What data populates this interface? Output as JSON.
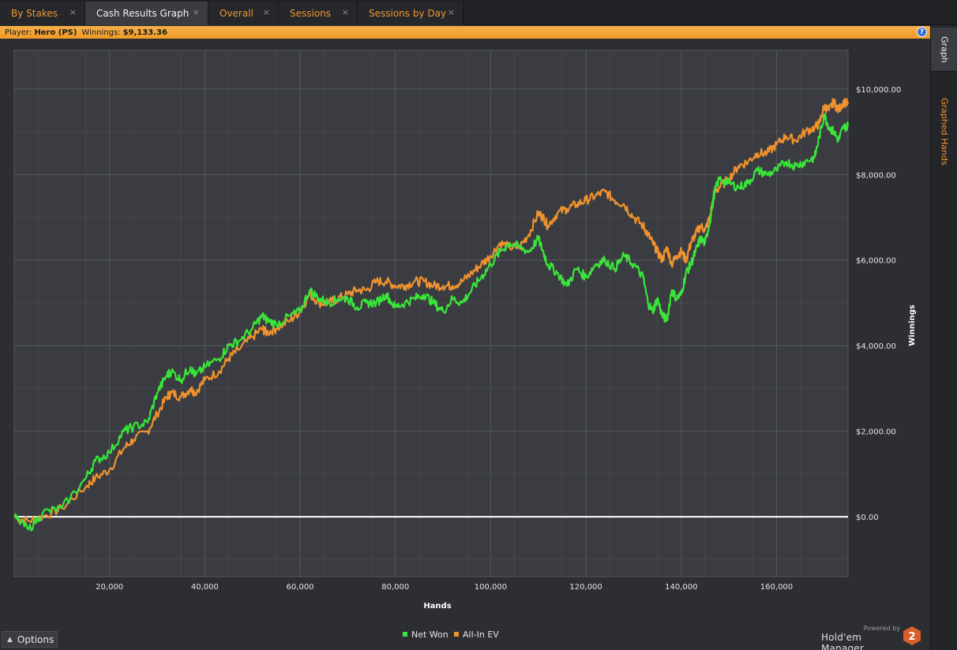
{
  "tabs": [
    {
      "label": "By Stakes",
      "active": false
    },
    {
      "label": "Cash Results Graph",
      "active": true
    },
    {
      "label": "Overall",
      "active": false
    },
    {
      "label": "Sessions",
      "active": false
    },
    {
      "label": "Sessions by Day",
      "active": false
    }
  ],
  "close_glyph": "×",
  "player_bar": {
    "player_label": "Player:",
    "player_value": "Hero (PS)",
    "winnings_label": "Winnings:",
    "winnings_value": "$9,133.36",
    "help_glyph": "?"
  },
  "side_tabs": {
    "graph": "Graph",
    "graphed_hands": "Graphed Hands"
  },
  "options_label": "Options",
  "brand": {
    "powered_by": "Powered by",
    "name": "Hold'em Manager",
    "logo_number": "2"
  },
  "colors": {
    "net_won": "#39e639",
    "all_in_ev": "#f0922e",
    "accent": "#f0962e",
    "zero_line": "#ffffff"
  },
  "chart_data": {
    "type": "line",
    "xlabel": "Hands",
    "ylabel": "Winnings",
    "xlim": [
      0,
      175000
    ],
    "ylim": [
      -1400,
      10900
    ],
    "x_ticks": [
      20000,
      40000,
      60000,
      80000,
      100000,
      120000,
      140000,
      160000
    ],
    "x_tick_labels": [
      "20,000",
      "40,000",
      "60,000",
      "80,000",
      "100,000",
      "120,000",
      "140,000",
      "160,000"
    ],
    "y_ticks": [
      0,
      2000,
      4000,
      6000,
      8000,
      10000
    ],
    "y_tick_labels": [
      "$0.00",
      "$2,000.00",
      "$4,000.00",
      "$6,000.00",
      "$8,000.00",
      "$10,000.00"
    ],
    "y_axis_side": "right",
    "grid": true,
    "legend_position": "bottom-center",
    "series": [
      {
        "name": "Net Won",
        "color": "#39e639",
        "x": [
          0,
          3000,
          6000,
          10000,
          15000,
          17000,
          20000,
          23000,
          25000,
          28000,
          30000,
          32000,
          33000,
          35000,
          37000,
          38000,
          40000,
          43000,
          45000,
          47000,
          50000,
          52000,
          53000,
          55000,
          58000,
          60000,
          62000,
          64000,
          66000,
          68000,
          70000,
          72000,
          74000,
          76000,
          78000,
          80000,
          82000,
          84000,
          86000,
          88000,
          90000,
          92000,
          94000,
          96000,
          98000,
          100000,
          102000,
          104000,
          106000,
          108000,
          110000,
          111000,
          112000,
          114000,
          116000,
          118000,
          120000,
          122000,
          124000,
          126000,
          128000,
          130000,
          132000,
          133000,
          134000,
          135000,
          136000,
          137000,
          138000,
          139000,
          140000,
          141000,
          142000,
          143000,
          144000,
          145000,
          146000,
          147000,
          148000,
          150000,
          152000,
          154000,
          156000,
          158000,
          160000,
          162000,
          164000,
          166000,
          168000,
          169000,
          170000,
          171000,
          172000,
          173000,
          174000,
          175000
        ],
        "values": [
          0,
          -300,
          100,
          200,
          900,
          1300,
          1500,
          2000,
          2100,
          2200,
          2900,
          3300,
          3400,
          3200,
          3500,
          3300,
          3500,
          3700,
          4000,
          4100,
          4400,
          4700,
          4600,
          4500,
          4700,
          4800,
          5300,
          5100,
          5000,
          5100,
          5100,
          4900,
          5000,
          5000,
          5200,
          4900,
          5000,
          5100,
          5200,
          5000,
          4800,
          5100,
          5000,
          5300,
          5600,
          5900,
          6200,
          6400,
          6300,
          6200,
          6500,
          6200,
          5900,
          5700,
          5400,
          5800,
          5600,
          5900,
          6000,
          5800,
          6100,
          5900,
          5600,
          5000,
          4800,
          5100,
          4700,
          4600,
          5300,
          5100,
          5200,
          5700,
          5900,
          6200,
          6500,
          6400,
          6900,
          7600,
          7900,
          7800,
          7700,
          7800,
          8100,
          8000,
          8100,
          8300,
          8200,
          8300,
          8400,
          8900,
          9400,
          9100,
          9000,
          8800,
          9100,
          9133
        ]
      },
      {
        "name": "All-In EV",
        "color": "#f0922e",
        "x": [
          0,
          3000,
          6000,
          10000,
          15000,
          17000,
          20000,
          23000,
          25000,
          28000,
          30000,
          32000,
          33000,
          35000,
          37000,
          38000,
          40000,
          43000,
          45000,
          47000,
          50000,
          52000,
          53000,
          55000,
          58000,
          60000,
          62000,
          64000,
          66000,
          68000,
          70000,
          72000,
          74000,
          76000,
          78000,
          80000,
          82000,
          84000,
          86000,
          88000,
          90000,
          92000,
          94000,
          96000,
          98000,
          100000,
          102000,
          104000,
          106000,
          108000,
          110000,
          111000,
          112000,
          114000,
          116000,
          118000,
          120000,
          122000,
          124000,
          126000,
          128000,
          130000,
          132000,
          133000,
          134000,
          135000,
          136000,
          137000,
          138000,
          139000,
          140000,
          141000,
          142000,
          143000,
          144000,
          145000,
          146000,
          147000,
          148000,
          150000,
          152000,
          154000,
          156000,
          158000,
          160000,
          162000,
          164000,
          166000,
          168000,
          169000,
          170000,
          171000,
          172000,
          173000,
          174000,
          175000
        ],
        "values": [
          0,
          -100,
          0,
          200,
          700,
          900,
          1100,
          1600,
          1800,
          2000,
          2400,
          2800,
          2900,
          2800,
          3000,
          2900,
          3200,
          3400,
          3700,
          3900,
          4200,
          4400,
          4300,
          4400,
          4600,
          4800,
          5200,
          5000,
          5000,
          5100,
          5200,
          5300,
          5300,
          5500,
          5500,
          5400,
          5400,
          5500,
          5500,
          5400,
          5400,
          5400,
          5500,
          5700,
          5900,
          6100,
          6400,
          6300,
          6300,
          6600,
          7100,
          7000,
          6800,
          7100,
          7200,
          7300,
          7400,
          7500,
          7600,
          7400,
          7300,
          7000,
          6800,
          6600,
          6400,
          6200,
          6000,
          6300,
          5900,
          6100,
          6200,
          6000,
          6400,
          6600,
          6800,
          6700,
          7000,
          7600,
          7700,
          7900,
          8200,
          8300,
          8500,
          8500,
          8700,
          8900,
          8800,
          9000,
          9100,
          9200,
          9600,
          9500,
          9700,
          9500,
          9700,
          9650
        ]
      }
    ]
  }
}
